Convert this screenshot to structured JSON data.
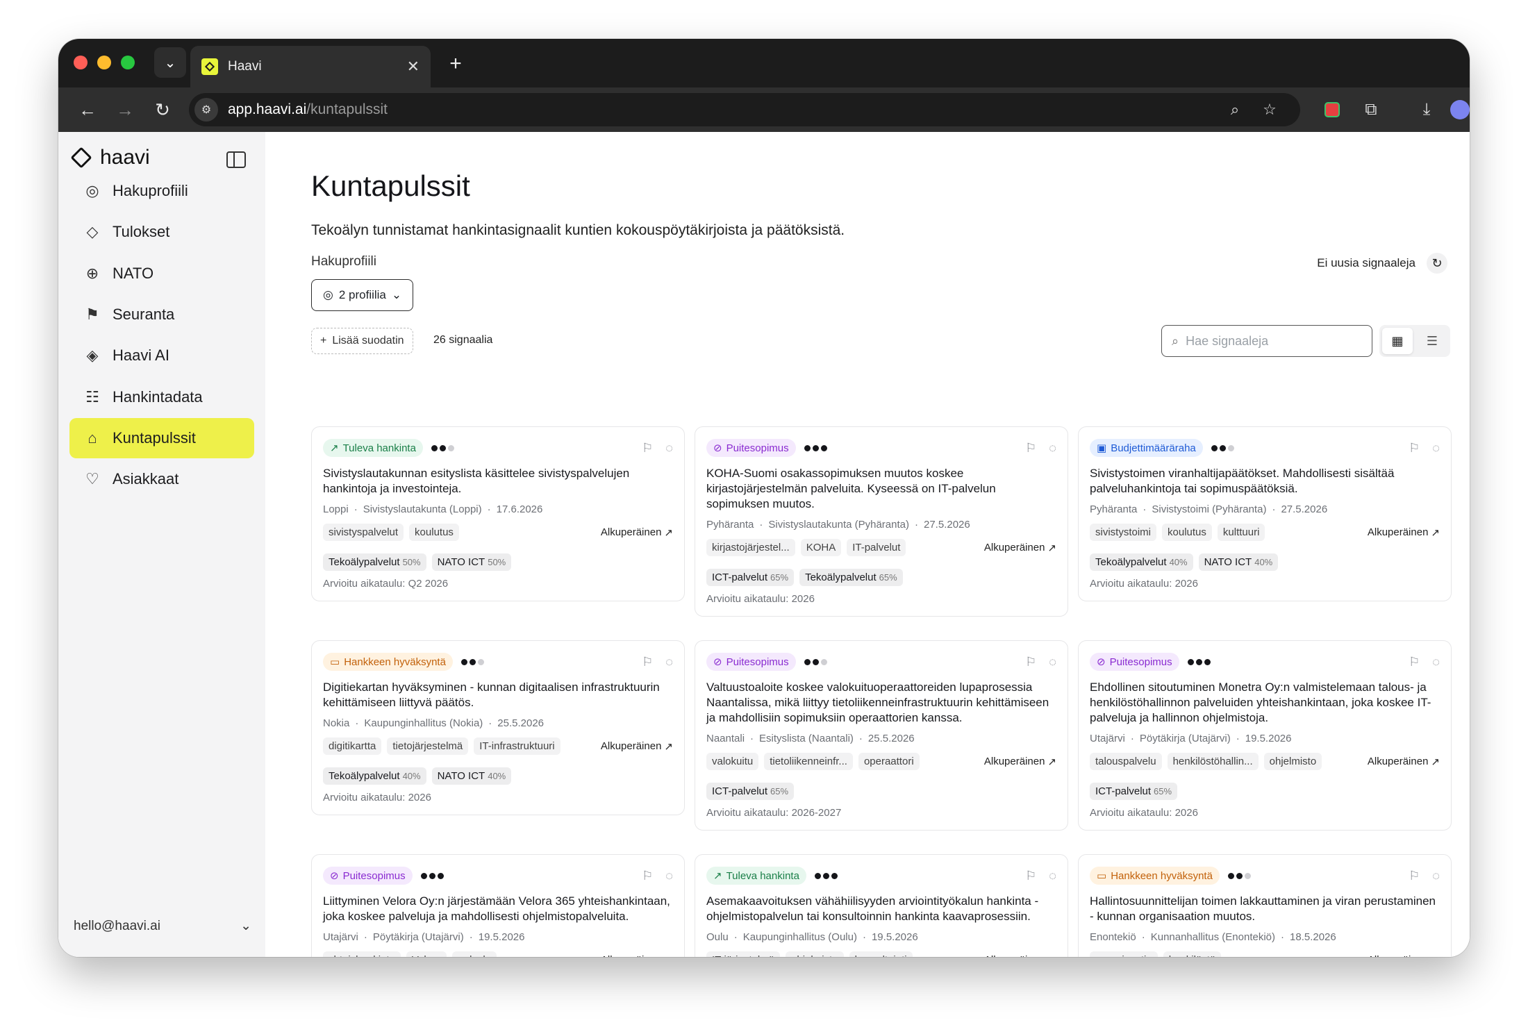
{
  "browser": {
    "tab_title": "Haavi",
    "url_host": "app.haavi.ai",
    "url_path": "/kuntapulssit"
  },
  "sidebar": {
    "brand": "haavi",
    "items": [
      {
        "label": "Hakuprofiili",
        "icon": "fingerprint-icon"
      },
      {
        "label": "Tulokset",
        "icon": "tag-icon"
      },
      {
        "label": "NATO",
        "icon": "compass-icon"
      },
      {
        "label": "Seuranta",
        "icon": "flag-icon"
      },
      {
        "label": "Haavi AI",
        "icon": "sparkle-diamond-icon"
      },
      {
        "label": "Hankintadata",
        "icon": "database-icon"
      },
      {
        "label": "Kuntapulssit",
        "icon": "building-signal-icon",
        "active": true
      },
      {
        "label": "Asiakkaat",
        "icon": "handshake-icon"
      }
    ],
    "user_email": "hello@haavi.ai"
  },
  "main": {
    "title": "Kuntapulssit",
    "subtitle": "Tekoälyn tunnistamat hankintasignaalit kuntien kokouspöytäkirjoista ja päätöksistä.",
    "profile_label": "Hakuprofiili",
    "profile_button": "2 profiilia",
    "status_text": "Ei uusia signaaleja",
    "add_filter": "Lisää suodatin",
    "count": "26 signaalia",
    "search_placeholder": "Hae signaaleja",
    "original_label": "Alkuperäinen"
  },
  "colors": {
    "accent": "#eef04a",
    "badge_green": "#1a7f48",
    "badge_purple": "#8a2bd1",
    "badge_blue": "#1f5bd6",
    "badge_orange": "#c2610a"
  },
  "cards": [
    {
      "badge": "Tuleva hankinta",
      "badge_color": "green",
      "badge_icon": "trend-up-icon",
      "strength": 2,
      "title": "Sivistyslautakunnan esityslista käsittelee sivistyspalvelujen hankintoja ja investointeja.",
      "municipality": "Loppi",
      "body": "Sivistyslautakunta (Loppi)",
      "date": "17.6.2026",
      "tags": [
        "sivistyspalvelut",
        "koulutus"
      ],
      "scores": [
        {
          "name": "Tekoälypalvelut",
          "pct": "50%"
        },
        {
          "name": "NATO ICT",
          "pct": "50%"
        }
      ],
      "timeline": "Arvioitu aikataulu: Q2 2026"
    },
    {
      "badge": "Puitesopimus",
      "badge_color": "purple",
      "badge_icon": "link-icon",
      "strength": 3,
      "title": "KOHA-Suomi osakassopimuksen muutos koskee kirjastojärjestelmän palveluita. Kyseessä on IT-palvelun sopimuksen muutos.",
      "municipality": "Pyhäranta",
      "body": "Sivistyslautakunta (Pyhäranta)",
      "date": "27.5.2026",
      "tags": [
        "kirjastojärjestel...",
        "KOHA",
        "IT-palvelut"
      ],
      "scores": [
        {
          "name": "ICT-palvelut",
          "pct": "65%"
        },
        {
          "name": "Tekoälypalvelut",
          "pct": "65%"
        }
      ],
      "timeline": "Arvioitu aikataulu: 2026"
    },
    {
      "badge": "Budjettimääräraha",
      "badge_color": "blue",
      "badge_icon": "wallet-icon",
      "strength": 2,
      "title": "Sivistystoimen viranhaltijapäätökset. Mahdollisesti sisältää palveluhankintoja tai sopimuspäätöksiä.",
      "municipality": "Pyhäranta",
      "body": "Sivistystoimi (Pyhäranta)",
      "date": "27.5.2026",
      "tags": [
        "sivistystoimi",
        "koulutus",
        "kulttuuri"
      ],
      "scores": [
        {
          "name": "Tekoälypalvelut",
          "pct": "40%"
        },
        {
          "name": "NATO ICT",
          "pct": "40%"
        }
      ],
      "timeline": "Arvioitu aikataulu: 2026"
    },
    {
      "badge": "Hankkeen hyväksyntä",
      "badge_color": "orange",
      "badge_icon": "folder-icon",
      "strength": 2,
      "title": "Digitiekartan hyväksyminen - kunnan digitaalisen infrastruktuurin kehittämiseen liittyvä päätös.",
      "municipality": "Nokia",
      "body": "Kaupunginhallitus (Nokia)",
      "date": "25.5.2026",
      "tags": [
        "digitikartta",
        "tietojärjestelmä",
        "IT-infrastruktuuri"
      ],
      "scores": [
        {
          "name": "Tekoälypalvelut",
          "pct": "40%"
        },
        {
          "name": "NATO ICT",
          "pct": "40%"
        }
      ],
      "timeline": "Arvioitu aikataulu: 2026"
    },
    {
      "badge": "Puitesopimus",
      "badge_color": "purple",
      "badge_icon": "link-icon",
      "strength": 2,
      "title": "Valtuustoaloite koskee valokuituoperaattoreiden lupaprosessia Naantalissa, mikä liittyy tietoliikenneinfrastruktuurin kehittämiseen ja mahdollisiin sopimuksiin operaattorien kanssa.",
      "municipality": "Naantali",
      "body": "Esityslista (Naantali)",
      "date": "25.5.2026",
      "tags": [
        "valokuitu",
        "tietoliikenneinfr...",
        "operaattori"
      ],
      "scores": [
        {
          "name": "ICT-palvelut",
          "pct": "65%"
        }
      ],
      "timeline": "Arvioitu aikataulu: 2026-2027"
    },
    {
      "badge": "Puitesopimus",
      "badge_color": "purple",
      "badge_icon": "link-icon",
      "strength": 3,
      "title": "Ehdollinen sitoutuminen Monetra Oy:n valmistelemaan talous- ja henkilöstöhallinnon palveluiden yhteishankintaan, joka koskee IT-palveluja ja hallinnon ohjelmistoja.",
      "municipality": "Utajärvi",
      "body": "Pöytäkirja (Utajärvi)",
      "date": "19.5.2026",
      "tags": [
        "talouspalvelu",
        "henkilöstöhallin...",
        "ohjelmisto"
      ],
      "scores": [
        {
          "name": "ICT-palvelut",
          "pct": "65%"
        }
      ],
      "timeline": "Arvioitu aikataulu: 2026"
    },
    {
      "badge": "Puitesopimus",
      "badge_color": "purple",
      "badge_icon": "link-icon",
      "strength": 3,
      "title": "Liittyminen Velora Oy:n järjestämään Velora 365 yhteishankintaan, joka koskee palveluja ja mahdollisesti ohjelmistopalveluita.",
      "municipality": "Utajärvi",
      "body": "Pöytäkirja (Utajärvi)",
      "date": "19.5.2026",
      "tags": [
        "yhteishankinta",
        "Velora",
        "palvelu"
      ],
      "scores": [],
      "timeline": ""
    },
    {
      "badge": "Tuleva hankinta",
      "badge_color": "green",
      "badge_icon": "trend-up-icon",
      "strength": 3,
      "title": "Asemakaavoituksen vähähiilisyyden arviointityökalun hankinta - ohjelmistopalvelun tai konsultoinnin hankinta kaavaprosessiin.",
      "municipality": "Oulu",
      "body": "Kaupunginhallitus (Oulu)",
      "date": "19.5.2026",
      "tags": [
        "IT-järjestelmä",
        "ohjelmisto",
        "konsultointi"
      ],
      "scores": [],
      "timeline": ""
    },
    {
      "badge": "Hankkeen hyväksyntä",
      "badge_color": "orange",
      "badge_icon": "folder-icon",
      "strength": 2,
      "title": "Hallintosuunnittelijan toimen lakkauttaminen ja viran perustaminen - kunnan organisaation muutos.",
      "municipality": "Enontekiö",
      "body": "Kunnanhallitus (Enontekiö)",
      "date": "18.5.2026",
      "tags": [
        "organisaatio",
        "henkilöstö"
      ],
      "scores": [],
      "timeline": ""
    }
  ]
}
